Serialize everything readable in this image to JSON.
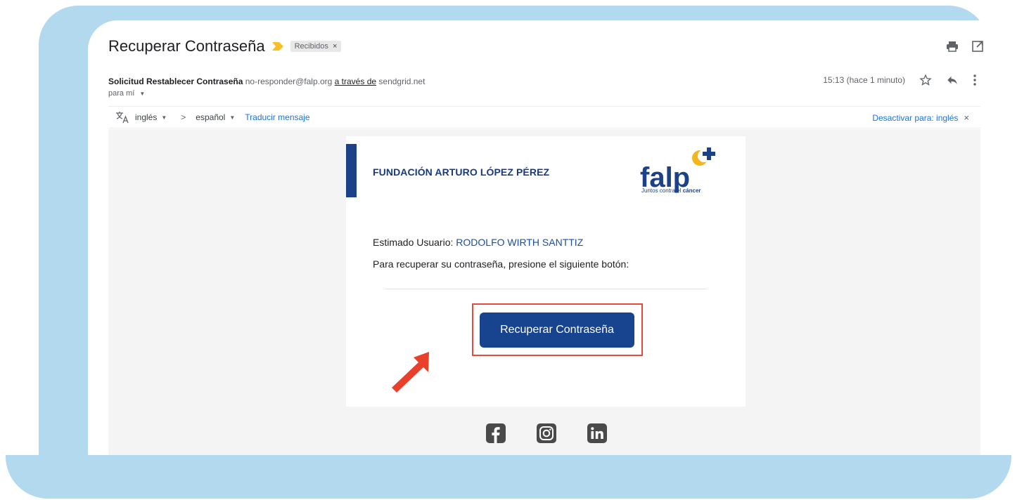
{
  "email": {
    "subject": "Recuperar Contraseña",
    "label": "Recibidos",
    "label_close": "×",
    "sender_name": "Solicitud Restablecer Contraseña",
    "sender_email": "no-responder@falp.org",
    "via_text": "a través de",
    "via_domain": "sendgrid.net",
    "recipient": "para mí",
    "timestamp": "15:13 (hace 1 minuto)"
  },
  "translate_bar": {
    "from_lang": "inglés",
    "to_lang": "español",
    "translate_link": "Traducir mensaje",
    "disable_label": "Desactivar para: inglés",
    "close": "×"
  },
  "body": {
    "foundation_name": "FUNDACIÓN ARTURO LÓPEZ PÉREZ",
    "logo_text": "falp",
    "tagline_prefix": "Juntos contra el",
    "tagline_bold": "cáncer",
    "greeting_label": "Estimado Usuario:",
    "user_name": "RODOLFO WIRTH SANTTIZ",
    "instruction": "Para recuperar su contraseña, presione el siguiente botón:",
    "button_label": "Recuperar Contraseña"
  },
  "icons": [
    "importance-marker-icon",
    "print-icon",
    "open-in-new-window-icon",
    "star-icon",
    "reply-icon",
    "more-vertical-icon",
    "translate-icon",
    "facebook-icon",
    "instagram-icon",
    "linkedin-icon",
    "annotation-arrow-icon"
  ],
  "colors": {
    "frame": "#b3d9ef",
    "brand_blue": "#18438e",
    "highlight_red": "#e64a3d",
    "link_blue": "#1a73e8"
  }
}
